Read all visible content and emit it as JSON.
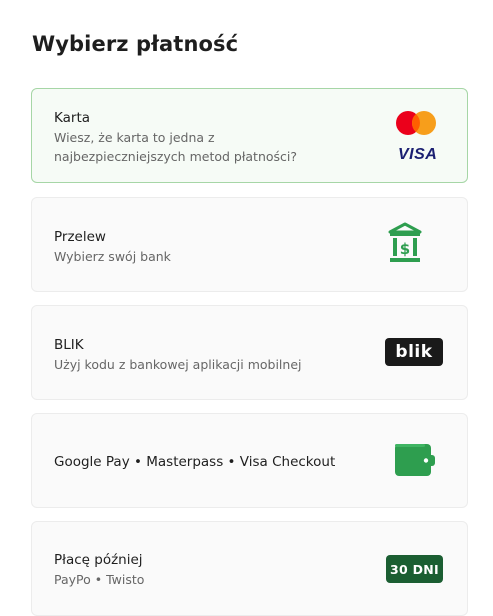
{
  "page": {
    "title": "Wybierz płatność"
  },
  "colors": {
    "accent_green": "#2e9e4f",
    "selected_border": "#a6d6a6",
    "visa_blue": "#1a1f71",
    "mastercard_red": "#eb001b",
    "mastercard_orange": "#f79e1b"
  },
  "methods": [
    {
      "name": "Karta",
      "description": "Wiesz, że karta to jedna z najbezpieczniejszych metod płatności?",
      "description_lines": [
        "Wiesz, że karta to jedna z",
        "najbezpieczniejszych metod płatności?"
      ],
      "logo_text": "VISA",
      "icons": [
        "mastercard-icon",
        "visa-logo"
      ],
      "selected": true
    },
    {
      "name": "Przelew",
      "description": "Wybierz swój bank",
      "icons": [
        "bank-icon"
      ],
      "selected": false
    },
    {
      "name": "BLIK",
      "description": "Użyj kodu z bankowej aplikacji mobilnej",
      "logo_text": "blik",
      "icons": [
        "blik-logo"
      ],
      "selected": false
    },
    {
      "name": "Google Pay • Masterpass • Visa Checkout",
      "icons": [
        "wallet-icon"
      ],
      "selected": false
    },
    {
      "name": "Płacę później",
      "description": "PayPo • Twisto",
      "logo_text": "30 DNI",
      "icons": [
        "30-dni-badge"
      ],
      "selected": false
    }
  ]
}
